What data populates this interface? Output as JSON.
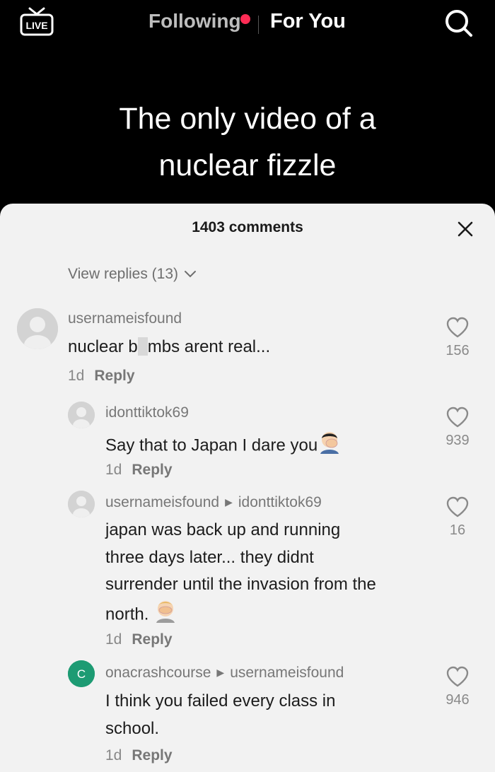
{
  "topbar": {
    "live_label": "LIVE",
    "following_label": "Following",
    "foryou_label": "For You"
  },
  "video": {
    "title_line1": "The only video of a",
    "title_line2": "nuclear fizzle"
  },
  "comments_panel": {
    "header": "1403 comments",
    "view_replies": "View replies (13)",
    "comments": [
      {
        "username": "usernameisfound",
        "text_before": "nuclear b",
        "text_after": "mbs arent real...",
        "time": "1d",
        "reply_label": "Reply",
        "likes": "156"
      },
      {
        "username": "idonttiktok69",
        "text": "Say that to Japan I dare you",
        "time": "1d",
        "reply_label": "Reply",
        "likes": "939"
      },
      {
        "username": "usernameisfound",
        "reply_to": "idonttiktok69",
        "text_lines": [
          "japan was back up and running",
          "three days later... they didnt",
          "surrender until the invasion from the"
        ],
        "text_last": "north.",
        "time": "1d",
        "reply_label": "Reply",
        "likes": "16"
      },
      {
        "username": "onacrashcourse",
        "reply_to": "usernameisfound",
        "avatar_letter": "C",
        "text_lines": [
          "I think you failed every class in",
          "school."
        ],
        "time": "1d",
        "reply_label": "Reply",
        "likes": "946"
      }
    ]
  },
  "colors": {
    "accent_red": "#fe2c55",
    "avatar_green": "#1d9b73"
  }
}
